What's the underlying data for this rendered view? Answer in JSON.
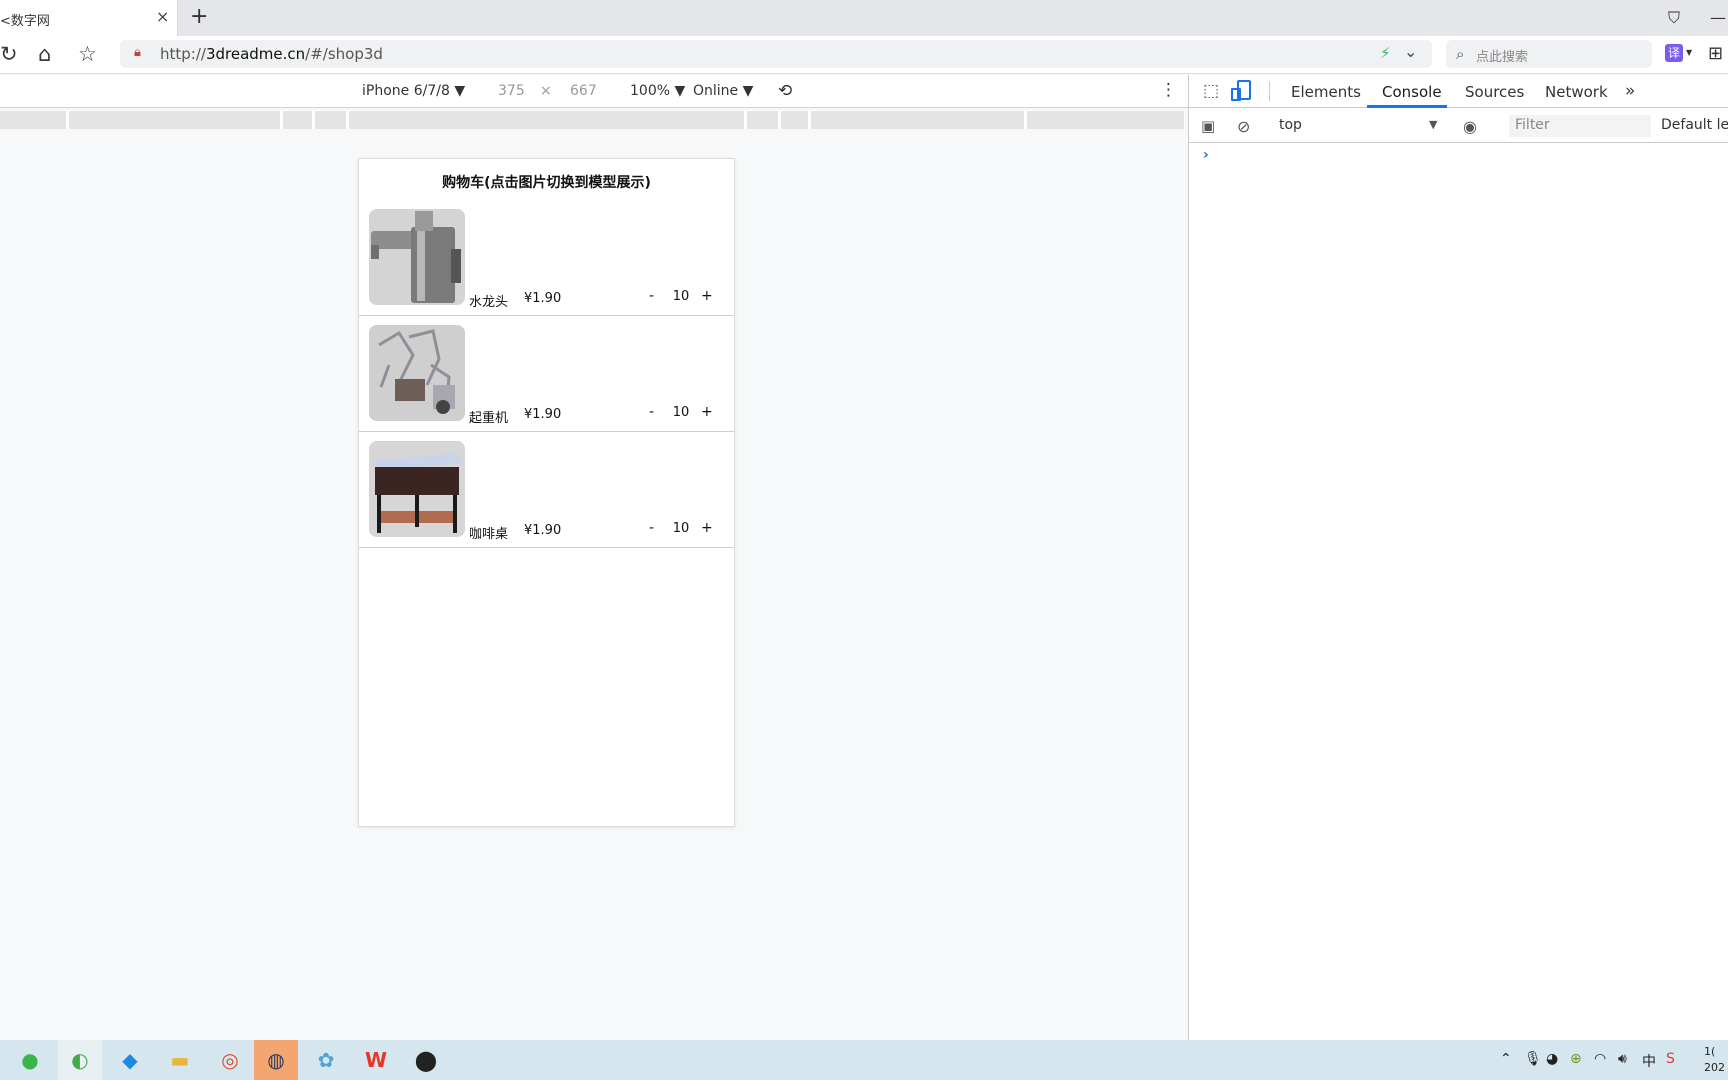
{
  "browser": {
    "tab_title": "<数字网",
    "tab_close": "×",
    "new_tab": "+",
    "url_prefix": "http://",
    "url_host": "3dreadme.cn",
    "url_path": "/#/shop3d",
    "search_placeholder": "点此搜索",
    "translate_label": "译"
  },
  "device_toolbar": {
    "device": "iPhone 6/7/8 ▼",
    "width": "375",
    "times": "×",
    "height": "667",
    "zoom": "100% ▼",
    "network": "Online ▼"
  },
  "cart": {
    "title": "购物车(点击图片切换到模型展示)",
    "items": [
      {
        "name": "水龙头",
        "price": "¥1.90",
        "qty": "10",
        "minus": "-",
        "plus": "+"
      },
      {
        "name": "起重机",
        "price": "¥1.90",
        "qty": "10",
        "minus": "-",
        "plus": "+"
      },
      {
        "name": "咖啡桌",
        "price": "¥1.90",
        "qty": "10",
        "minus": "-",
        "plus": "+"
      }
    ]
  },
  "devtools": {
    "tabs": [
      "Elements",
      "Console",
      "Sources",
      "Network"
    ],
    "active_tab": "Console",
    "context": "top",
    "filter_placeholder": "Filter",
    "levels": "Default lev",
    "prompt": "›"
  },
  "taskbar": {
    "clock_line1": "1(",
    "clock_line2": "202",
    "ime": "中",
    "active_color": "#f3a66f"
  },
  "colors": {
    "accent": "#1a73e8",
    "taskbar": "#d6e6ee"
  }
}
